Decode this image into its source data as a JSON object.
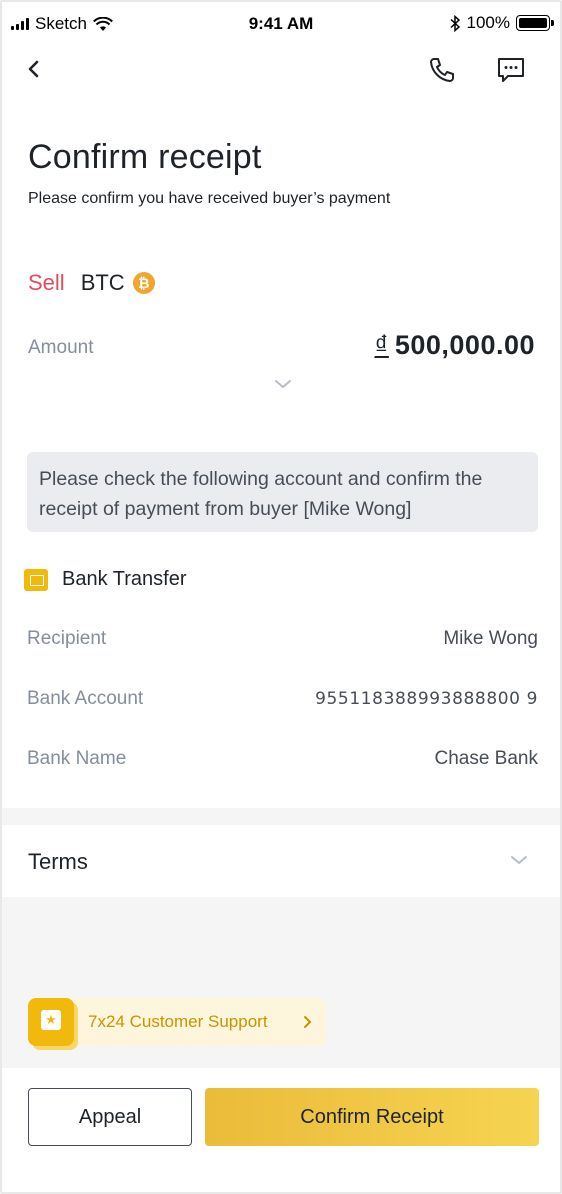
{
  "status_bar": {
    "carrier": "Sketch",
    "time": "9:41 AM",
    "battery": "100%",
    "battery_level": 1.0
  },
  "nav": {
    "icons": [
      "back-icon",
      "phone-icon",
      "chat-icon"
    ]
  },
  "header": {
    "title": "Confirm receipt",
    "subtitle": "Please confirm you have received buyer’s payment"
  },
  "trade": {
    "side": "Sell",
    "asset": "BTC",
    "asset_icon": "₿",
    "amount_label": "Amount",
    "currency_symbol": "₫",
    "amount": "500,000.00"
  },
  "notice": {
    "text": "Please check the following account and confirm the receipt of payment from buyer [Mike Wong]"
  },
  "payment": {
    "method": "Bank Transfer",
    "rows": [
      {
        "label": "Recipient",
        "value": "Mike Wong"
      },
      {
        "label": "Bank Account",
        "value": "955118388993888800 9"
      },
      {
        "label": "Bank Name",
        "value": "Chase Bank"
      }
    ]
  },
  "terms": {
    "label": "Terms"
  },
  "support": {
    "label": "7x24 Customer Support"
  },
  "actions": {
    "appeal_label": "Appeal",
    "confirm_label": "Confirm Receipt"
  },
  "colors": {
    "accent": "#F0B90B",
    "sell": "#E04D5C",
    "text_primary": "#1E2329",
    "text_secondary": "#848E9C"
  }
}
